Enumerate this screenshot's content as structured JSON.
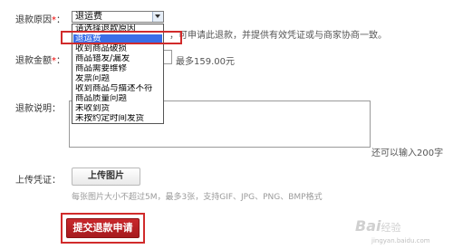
{
  "form": {
    "reason_label": "退款原因",
    "required_mark": "*",
    "reason_selected": "退运费",
    "reason_note": "，可申请此退款，并提供有效凭证或与商家协商一致。",
    "amount_label": "退款金额",
    "amount_required": "*",
    "amount_max": "最多159.00元",
    "desc_label": "退款说明",
    "desc_counter": "还可以输入200字",
    "upload_label": "上传凭证",
    "upload_button": "上传图片",
    "upload_hint": "每张图片大小不超过5M，最多3张，支持GIF、JPG、PNG、BMP格式",
    "submit_button": "提交退款申请"
  },
  "dropdown": {
    "options": [
      "请选择退款原因",
      "退运费",
      "收到商品破损",
      "商品错发/漏发",
      "商品需要维修",
      "发票问题",
      "收到商品与描述不符",
      "商品质量问题",
      "未收到货",
      "未按约定时间发货"
    ],
    "selected_index": 1
  },
  "watermark": {
    "text": "Bai",
    "suffix": "经验",
    "sub": "jingyan.baidu.com"
  },
  "colors": {
    "highlight": "#3a6ee8",
    "red": "#d12b2b",
    "submit": "#b42024"
  }
}
